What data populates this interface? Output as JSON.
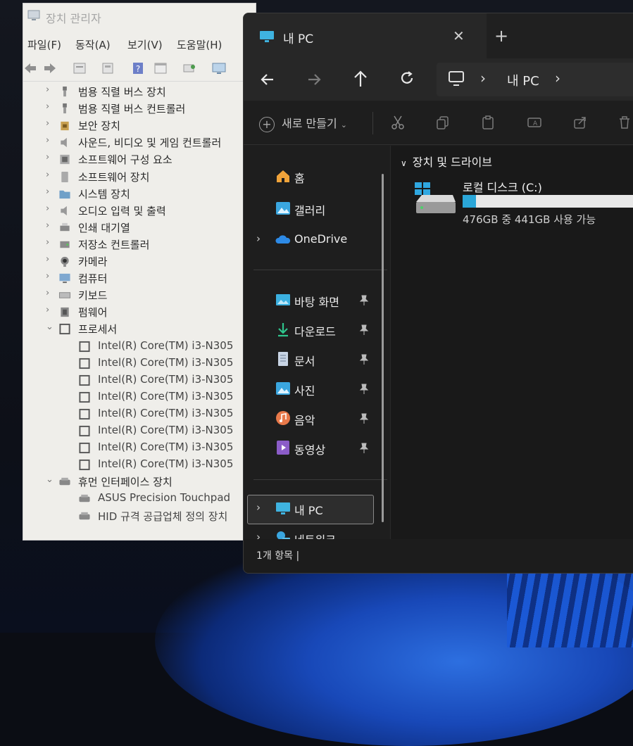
{
  "device_manager": {
    "title": "장치 관리자",
    "menu": [
      "파일(F)",
      "동작(A)",
      "보기(V)",
      "도움말(H)"
    ],
    "tree": [
      {
        "label": "범용 직렬 버스 장치",
        "expanded": false,
        "icon": "usb-icon"
      },
      {
        "label": "범용 직렬 버스 컨트롤러",
        "expanded": false,
        "icon": "usb-icon"
      },
      {
        "label": "보안 장치",
        "expanded": false,
        "icon": "security-icon"
      },
      {
        "label": "사운드, 비디오 및 게임 컨트롤러",
        "expanded": false,
        "icon": "speaker-icon"
      },
      {
        "label": "소프트웨어 구성 요소",
        "expanded": false,
        "icon": "component-icon"
      },
      {
        "label": "소프트웨어 장치",
        "expanded": false,
        "icon": "device-icon"
      },
      {
        "label": "시스템 장치",
        "expanded": false,
        "icon": "folder-icon"
      },
      {
        "label": "오디오 입력 및 출력",
        "expanded": false,
        "icon": "speaker-icon"
      },
      {
        "label": "인쇄 대기열",
        "expanded": false,
        "icon": "printer-icon"
      },
      {
        "label": "저장소 컨트롤러",
        "expanded": false,
        "icon": "storage-icon"
      },
      {
        "label": "카메라",
        "expanded": false,
        "icon": "camera-icon"
      },
      {
        "label": "컴퓨터",
        "expanded": false,
        "icon": "monitor-icon"
      },
      {
        "label": "키보드",
        "expanded": false,
        "icon": "keyboard-icon"
      },
      {
        "label": "펌웨어",
        "expanded": false,
        "icon": "chip-icon"
      },
      {
        "label": "프로세서",
        "expanded": true,
        "icon": "cpu-icon"
      },
      {
        "label": "Intel(R) Core(TM) i3-N305",
        "child": true,
        "icon": "cpu-icon"
      },
      {
        "label": "Intel(R) Core(TM) i3-N305",
        "child": true,
        "icon": "cpu-icon"
      },
      {
        "label": "Intel(R) Core(TM) i3-N305",
        "child": true,
        "icon": "cpu-icon"
      },
      {
        "label": "Intel(R) Core(TM) i3-N305",
        "child": true,
        "icon": "cpu-icon"
      },
      {
        "label": "Intel(R) Core(TM) i3-N305",
        "child": true,
        "icon": "cpu-icon"
      },
      {
        "label": "Intel(R) Core(TM) i3-N305",
        "child": true,
        "icon": "cpu-icon"
      },
      {
        "label": "Intel(R) Core(TM) i3-N305",
        "child": true,
        "icon": "cpu-icon"
      },
      {
        "label": "Intel(R) Core(TM) i3-N305",
        "child": true,
        "icon": "cpu-icon"
      },
      {
        "label": "휴먼 인터페이스 장치",
        "expanded": true,
        "icon": "hid-icon"
      },
      {
        "label": "ASUS Precision Touchpad",
        "child": true,
        "icon": "hid-icon"
      },
      {
        "label": "HID 규격 공급업체 정의 장치",
        "child": true,
        "icon": "hid-icon"
      }
    ]
  },
  "explorer": {
    "tab_title": "내 PC",
    "new_tab": "+",
    "close": "✕",
    "breadcrumb": [
      "내 PC"
    ],
    "new_button": "새로 만들기",
    "nav": {
      "home": "홈",
      "gallery": "갤러리",
      "onedrive": "OneDrive",
      "desktop": "바탕 화면",
      "downloads": "다운로드",
      "documents": "문서",
      "pictures": "사진",
      "music": "음악",
      "videos": "동영상",
      "this_pc": "내 PC",
      "network": "네트워크"
    },
    "group_label": "장치 및 드라이브",
    "drive": {
      "name": "로컬 디스크 (C:)",
      "size_text": "476GB 중 441GB 사용 가능",
      "used_fraction": 0.074,
      "fill_color": "#2aa6d8"
    },
    "status": "1개 항목  |"
  }
}
